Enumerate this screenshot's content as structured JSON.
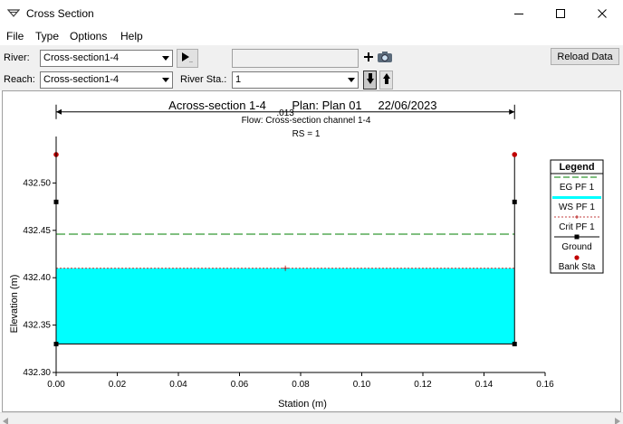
{
  "window": {
    "title": "Cross Section"
  },
  "menu": [
    "File",
    "Type",
    "Options",
    "Help"
  ],
  "toolbar": {
    "river_label": "River:",
    "river_value": "Cross-section1-4",
    "reach_label": "Reach:",
    "reach_value": "Cross-section1-4",
    "river_sta_label": "River Sta.:",
    "river_sta_value": "1",
    "reload_label": "Reload Data",
    "play_icon": "play-arrow-icon",
    "add_icon": "plus-icon",
    "camera_icon": "camera-icon"
  },
  "plot": {
    "title_left": "Across-section 1-4",
    "title_plan": "Plan: Plan 01",
    "title_date": "22/06/2023",
    "subtitle_flow": "Flow: Cross-section channel 1-4",
    "subtitle_rs": "RS = 1",
    "n_value_label": ".013",
    "legend_title": "Legend",
    "legend": [
      {
        "label": "EG PF 1",
        "color": "#007f00",
        "style": "dash"
      },
      {
        "label": "WS PF 1",
        "color": "#00ffff",
        "style": "fill"
      },
      {
        "label": "Crit PF 1",
        "color": "#b00000",
        "style": "dash-plus"
      },
      {
        "label": "Ground",
        "color": "#000000",
        "style": "line-square"
      },
      {
        "label": "Bank Sta",
        "color": "#c00000",
        "style": "dot"
      }
    ]
  },
  "chart_data": {
    "type": "line",
    "xlabel": "Station (m)",
    "ylabel": "Elevation (m)",
    "xlim": [
      0,
      0.16
    ],
    "ylim": [
      432.3,
      432.55
    ],
    "x_ticks": [
      "0.00",
      "0.02",
      "0.04",
      "0.06",
      "0.08",
      "0.10",
      "0.12",
      "0.14",
      "0.16"
    ],
    "x_tick_values": [
      0,
      0.02,
      0.04,
      0.06,
      0.08,
      0.1,
      0.12,
      0.14,
      0.16
    ],
    "y_ticks": [
      "432.30",
      "432.35",
      "432.40",
      "432.45",
      "432.50"
    ],
    "y_tick_values": [
      432.3,
      432.35,
      432.4,
      432.45,
      432.5
    ],
    "ground": {
      "x": [
        0,
        0,
        0,
        0.15,
        0.15,
        0.15
      ],
      "y": [
        432.53,
        432.48,
        432.33,
        432.33,
        432.48,
        432.53
      ]
    },
    "ground_markers": [
      [
        0,
        432.48
      ],
      [
        0,
        432.33
      ],
      [
        0.15,
        432.33
      ],
      [
        0.15,
        432.48
      ]
    ],
    "bank_sta": [
      [
        0,
        432.53
      ],
      [
        0.15,
        432.53
      ]
    ],
    "eg_pf1": 432.446,
    "ws_pf1": 432.41,
    "crit_pf1": 432.41,
    "crit_marker_x": 0.075,
    "n_value_y": 432.575
  }
}
